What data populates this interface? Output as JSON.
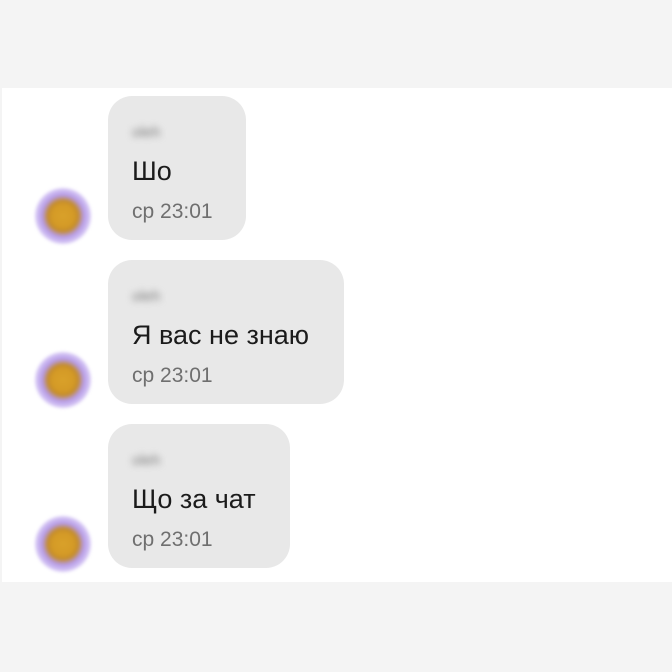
{
  "messages": [
    {
      "sender": "oleh",
      "text": "Шо",
      "time": "ср 23:01"
    },
    {
      "sender": "oleh",
      "text": "Я вас не знаю",
      "time": "ср 23:01"
    },
    {
      "sender": "oleh",
      "text": "Що за чат",
      "time": "ср 23:01"
    }
  ],
  "colors": {
    "background": "#f4f4f4",
    "panel": "#ffffff",
    "bubble": "#e8e8e8",
    "text": "#1b1b1b",
    "muted": "#6f6f6f"
  }
}
